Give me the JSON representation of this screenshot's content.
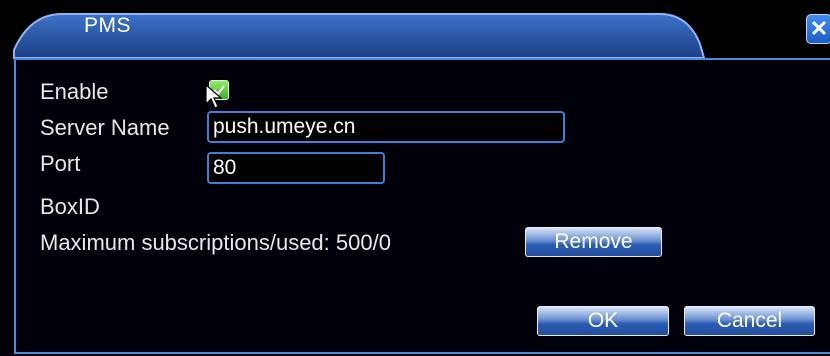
{
  "window": {
    "title": "PMS",
    "close_glyph": "✕"
  },
  "form": {
    "enable_label": "Enable",
    "enable_checked": true,
    "server_name_label": "Server Name",
    "server_name_value": "push.umeye.cn",
    "port_label": "Port",
    "port_value": "80",
    "boxid_label": "BoxID",
    "subscriptions_label": "Maximum subscriptions/used: 500/0"
  },
  "buttons": {
    "remove": "Remove",
    "ok": "OK",
    "cancel": "Cancel"
  },
  "colors": {
    "accent": "#3f7fd8",
    "check": "#5ccc3e",
    "background": "#000008"
  }
}
